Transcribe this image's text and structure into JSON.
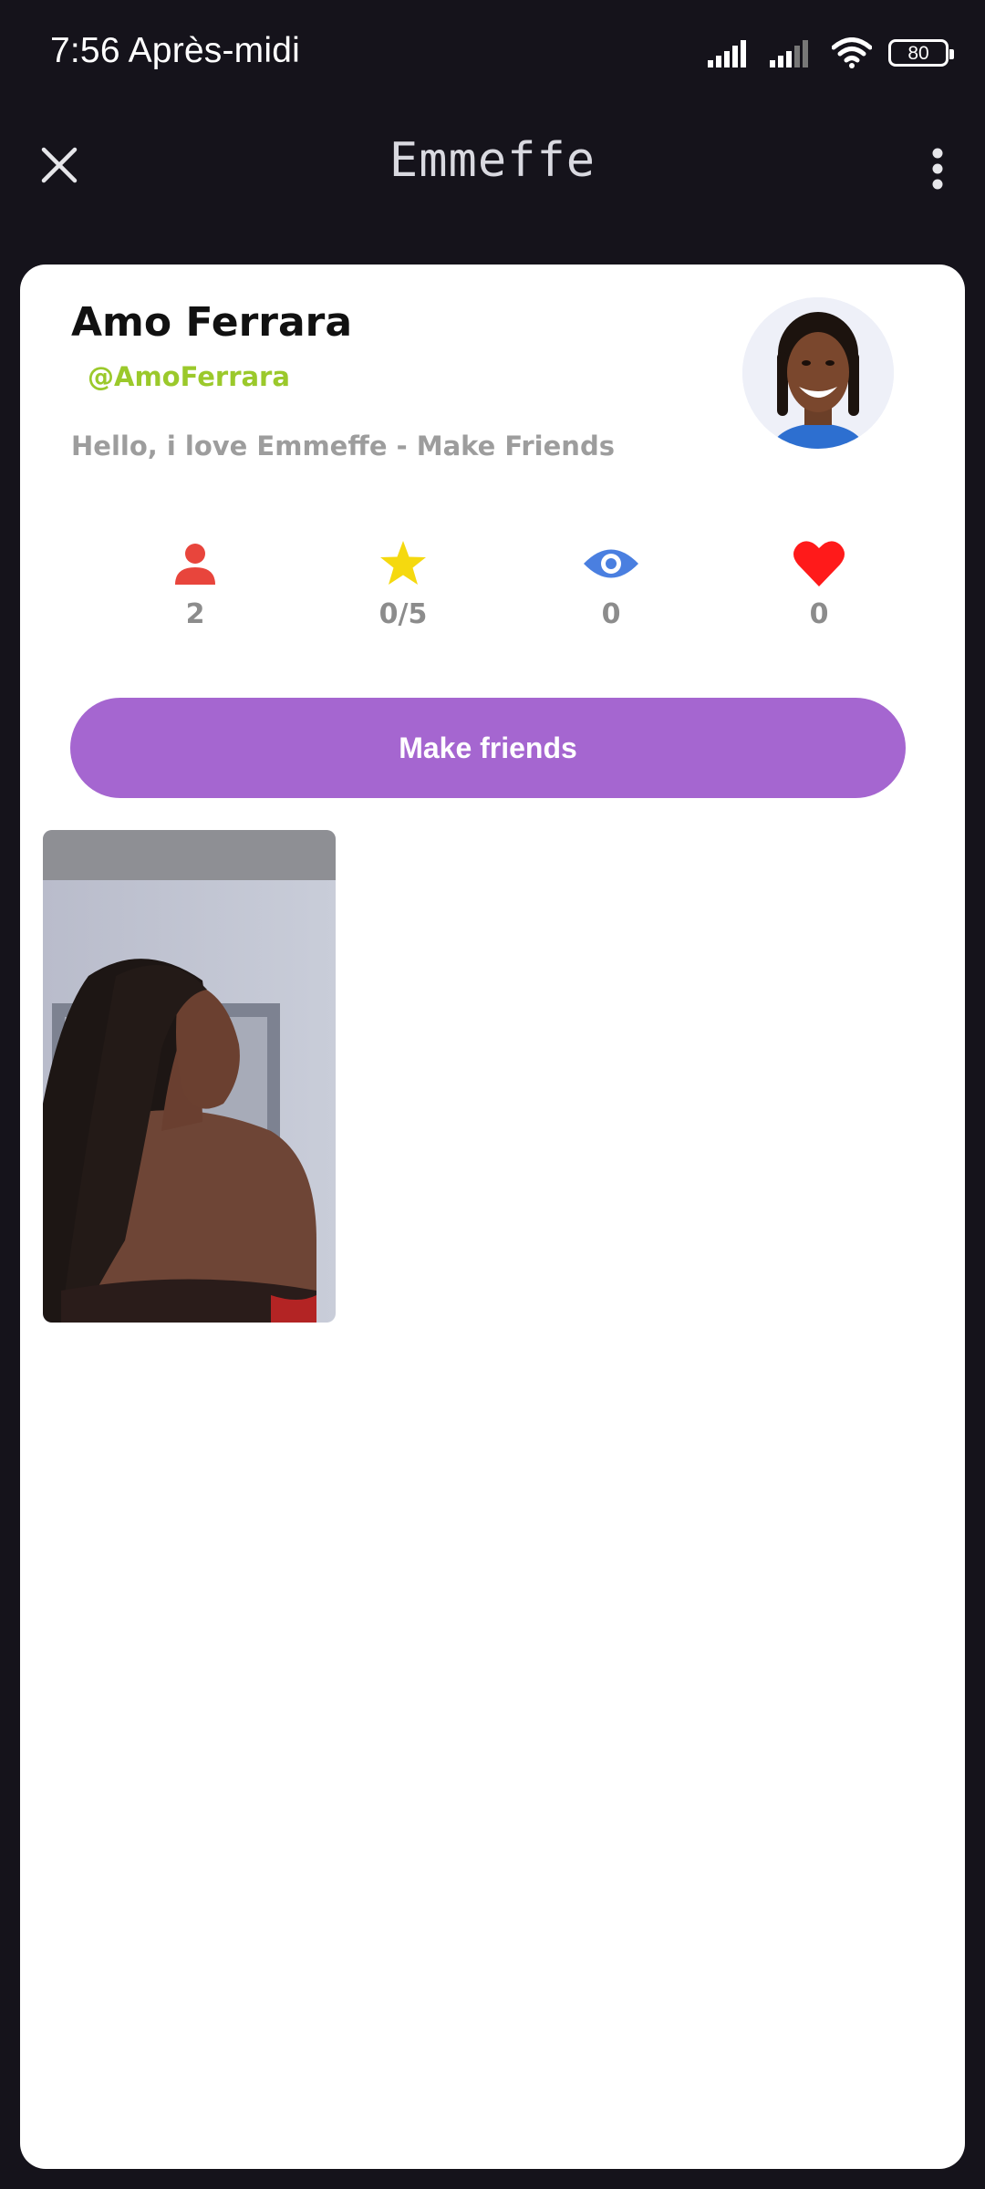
{
  "status_bar": {
    "time": "7:56 Après-midi",
    "battery": "80",
    "icons": [
      "signal-icon",
      "signal-icon",
      "wifi-icon",
      "battery-icon"
    ]
  },
  "app_bar": {
    "title": "Emmeffe",
    "icons": [
      "close-icon",
      "more-vertical-icon"
    ]
  },
  "profile": {
    "name": "Amo Ferrara",
    "handle": "@AmoFerrara",
    "bio": "Hello, i love Emmeffe - Make Friends"
  },
  "stats": [
    {
      "icon": "person-icon",
      "value": "2",
      "color": "#e8453c"
    },
    {
      "icon": "star-icon",
      "value": "0/5",
      "color": "#f5d90f"
    },
    {
      "icon": "eye-icon",
      "value": "0",
      "color": "#4a7fe0"
    },
    {
      "icon": "heart-icon",
      "value": "0",
      "color": "#ff1a1a"
    }
  ],
  "actions": {
    "make_friends": "Make friends"
  },
  "colors": {
    "background": "#15131b",
    "accent_button": "#a566d0",
    "handle": "#9bc92b"
  }
}
